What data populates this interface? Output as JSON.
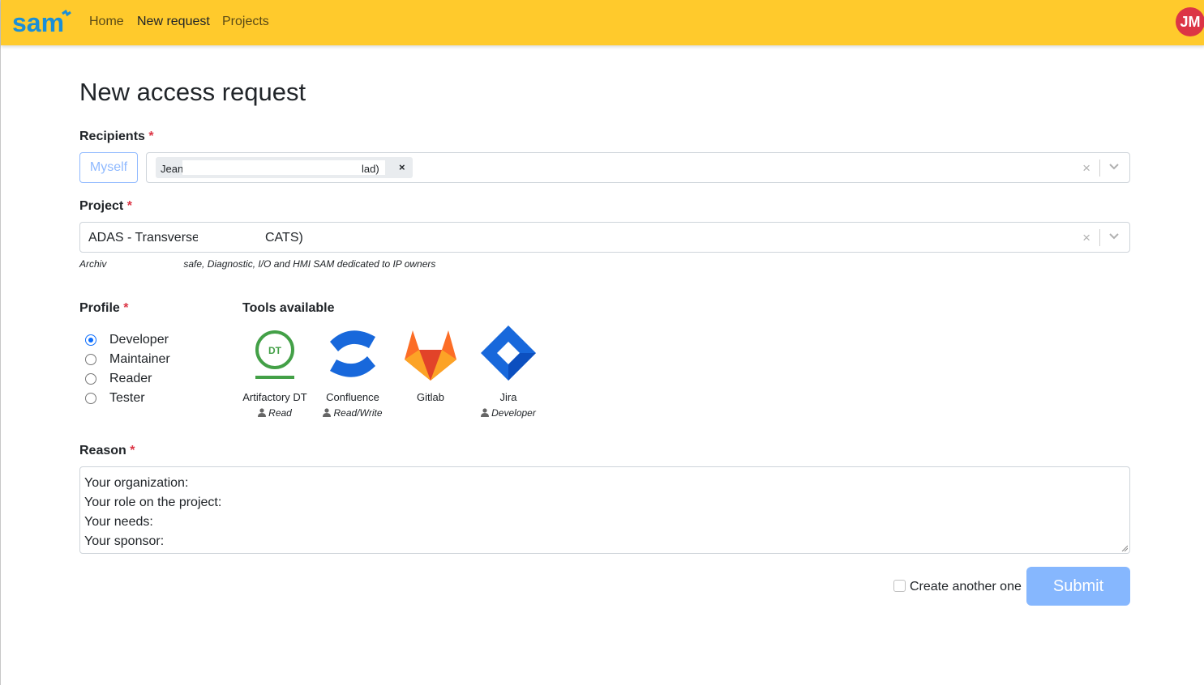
{
  "header": {
    "logo_text": "sam",
    "nav": [
      "Home",
      "New request",
      "Projects"
    ],
    "active_nav": "New request",
    "user_initials": "JM",
    "colors": {
      "bar": "#ffca2c",
      "avatar": "#dc3545"
    }
  },
  "page": {
    "title": "New access request"
  },
  "recipients": {
    "label": "Recipients",
    "required_mark": "*",
    "myself_button": "Myself",
    "chip_text_visible_start": "Jean",
    "chip_text_visible_end": "lad)",
    "chip_remove": "×",
    "clear": "×"
  },
  "project": {
    "label": "Project",
    "required_mark": "*",
    "value_start": "ADAS - Transverse",
    "value_end": "CATS)",
    "help_start": "Archiv",
    "help_end": "safe, Diagnostic, I/O and HMI SAM dedicated to IP owners",
    "clear": "×"
  },
  "profile": {
    "label": "Profile",
    "required_mark": "*",
    "options": [
      "Developer",
      "Maintainer",
      "Reader",
      "Tester"
    ],
    "selected": "Developer"
  },
  "tools": {
    "label": "Tools available",
    "items": [
      {
        "name": "Artifactory DT",
        "access": "Read",
        "icon": "artifactory-icon"
      },
      {
        "name": "Confluence",
        "access": "Read/Write",
        "icon": "confluence-icon"
      },
      {
        "name": "Gitlab",
        "access": "",
        "icon": "gitlab-icon"
      },
      {
        "name": "Jira",
        "access": "Developer",
        "icon": "jira-icon"
      }
    ],
    "artifactory_badge": "DT"
  },
  "reason": {
    "label": "Reason",
    "required_mark": "*",
    "lines": [
      "Your organization:",
      "Your role on the project:",
      "Your needs:",
      "Your sponsor:"
    ]
  },
  "footer": {
    "create_another": "Create another one",
    "submit": "Submit"
  }
}
